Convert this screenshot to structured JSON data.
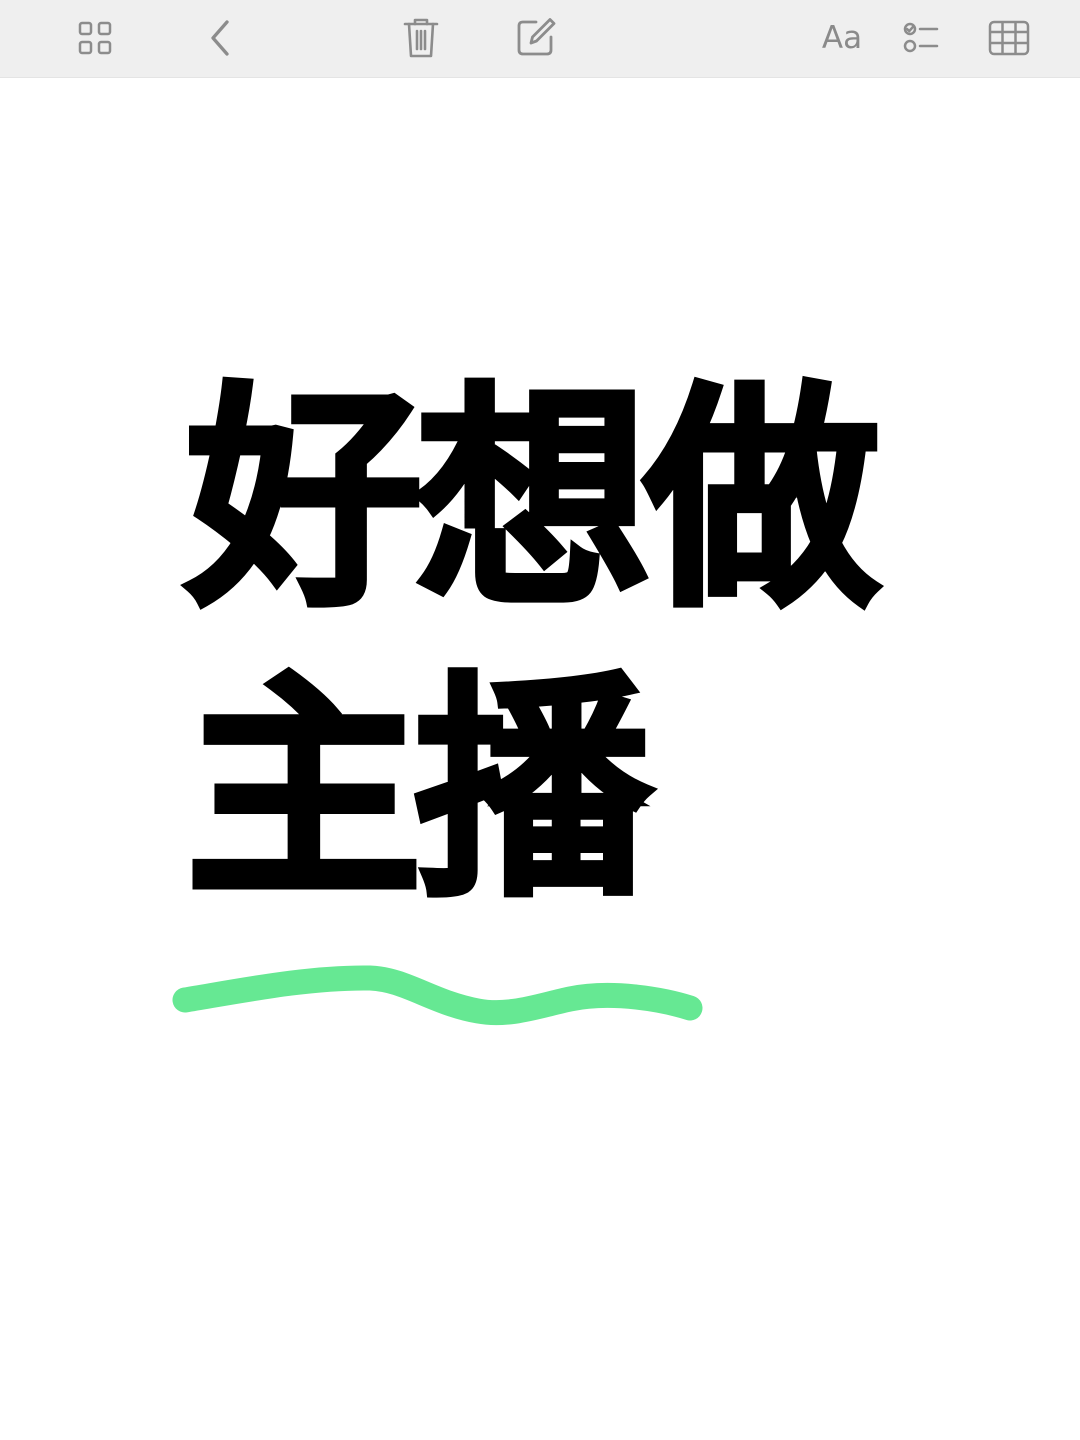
{
  "toolbar": {
    "items": [
      {
        "name": "gallery-view",
        "icon": "grid-icon"
      },
      {
        "name": "back",
        "icon": "chevron-left-icon"
      },
      {
        "name": "delete",
        "icon": "trash-icon"
      },
      {
        "name": "compose",
        "icon": "compose-icon"
      },
      {
        "name": "format",
        "icon": "text-format-icon",
        "label": "Aa"
      },
      {
        "name": "checklist",
        "icon": "checklist-icon"
      },
      {
        "name": "table",
        "icon": "table-icon"
      }
    ],
    "icon_color": "#8c8c8c",
    "background": "#efefef"
  },
  "note": {
    "line1": "好想做",
    "line2": "主播",
    "text_color": "#000000",
    "highlight_color": "#66e893"
  }
}
